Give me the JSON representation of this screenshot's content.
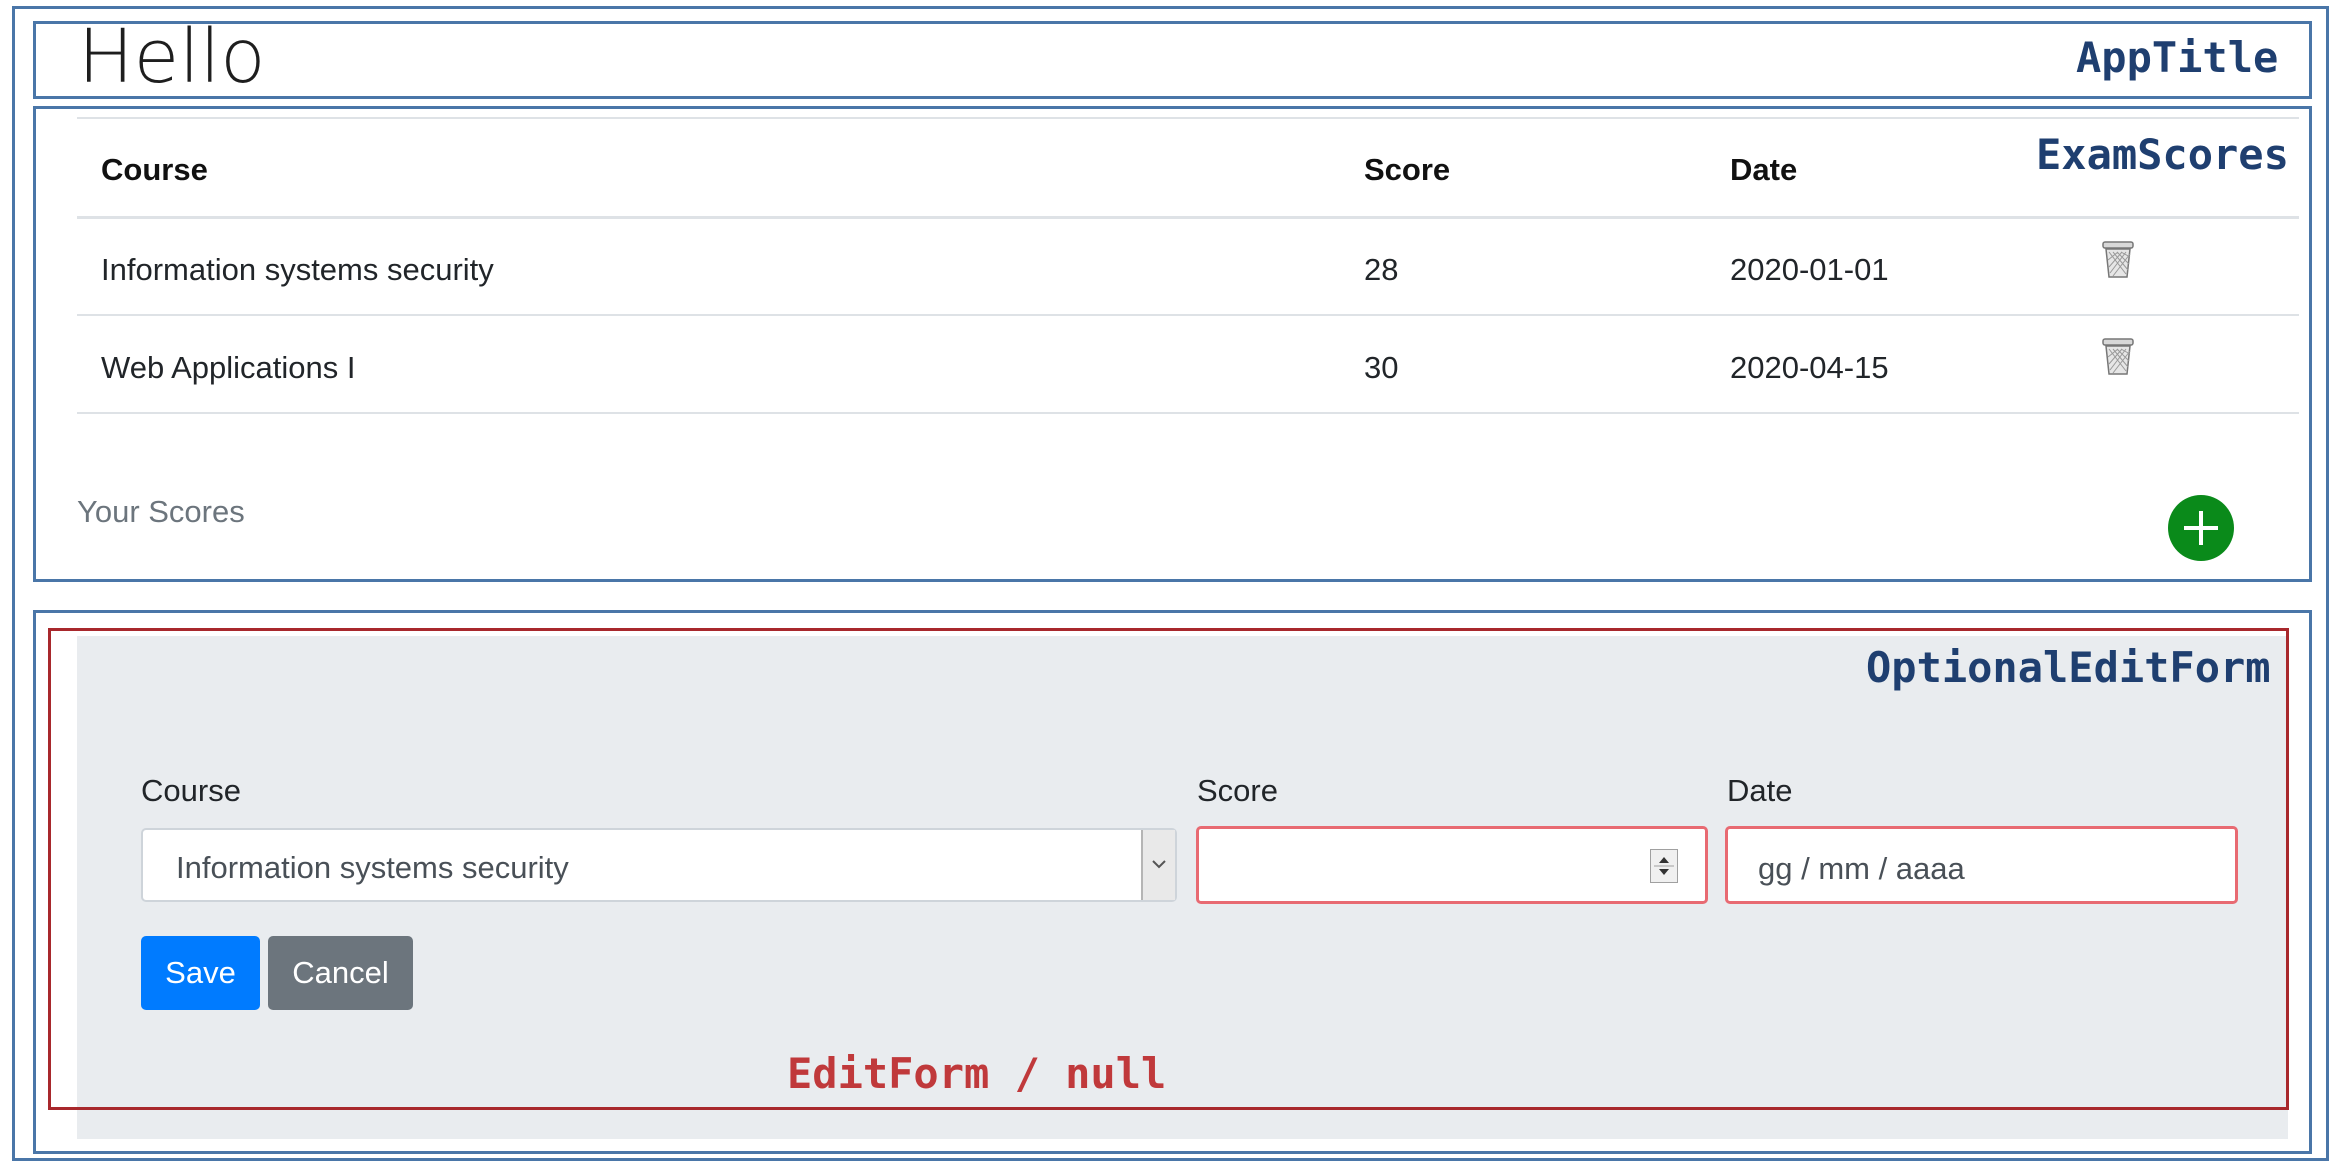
{
  "annotations": {
    "app_title": "AppTitle",
    "exam_scores": "ExamScores",
    "optional_edit_form": "OptionalEditForm",
    "edit_form_null": "EditForm / null"
  },
  "app": {
    "title": "Hello"
  },
  "table": {
    "headers": [
      "Course",
      "Score",
      "Date"
    ],
    "rows": [
      {
        "course": "Information systems security",
        "score": "28",
        "date": "2020-01-01"
      },
      {
        "course": "Web Applications I",
        "score": "30",
        "date": "2020-04-15"
      }
    ],
    "caption": "Your Scores"
  },
  "form": {
    "course_label": "Course",
    "course_value": "Information systems security",
    "score_label": "Score",
    "score_value": "",
    "date_label": "Date",
    "date_placeholder": "gg / mm / aaaa",
    "save_label": "Save",
    "cancel_label": "Cancel"
  },
  "colors": {
    "frame_blue": "#4a76a8",
    "annotation_blue": "#1f3f70",
    "annotation_red": "#c0393b",
    "add_button_green": "#0a8a1a",
    "save_blue": "#007bff",
    "cancel_gray": "#6c757d",
    "invalid_border": "#e86a72"
  },
  "icons": {
    "delete": "trash-icon",
    "add": "plus-circle-icon",
    "select": "chevron-down-icon",
    "spinner": "spinner-arrows-icon"
  }
}
